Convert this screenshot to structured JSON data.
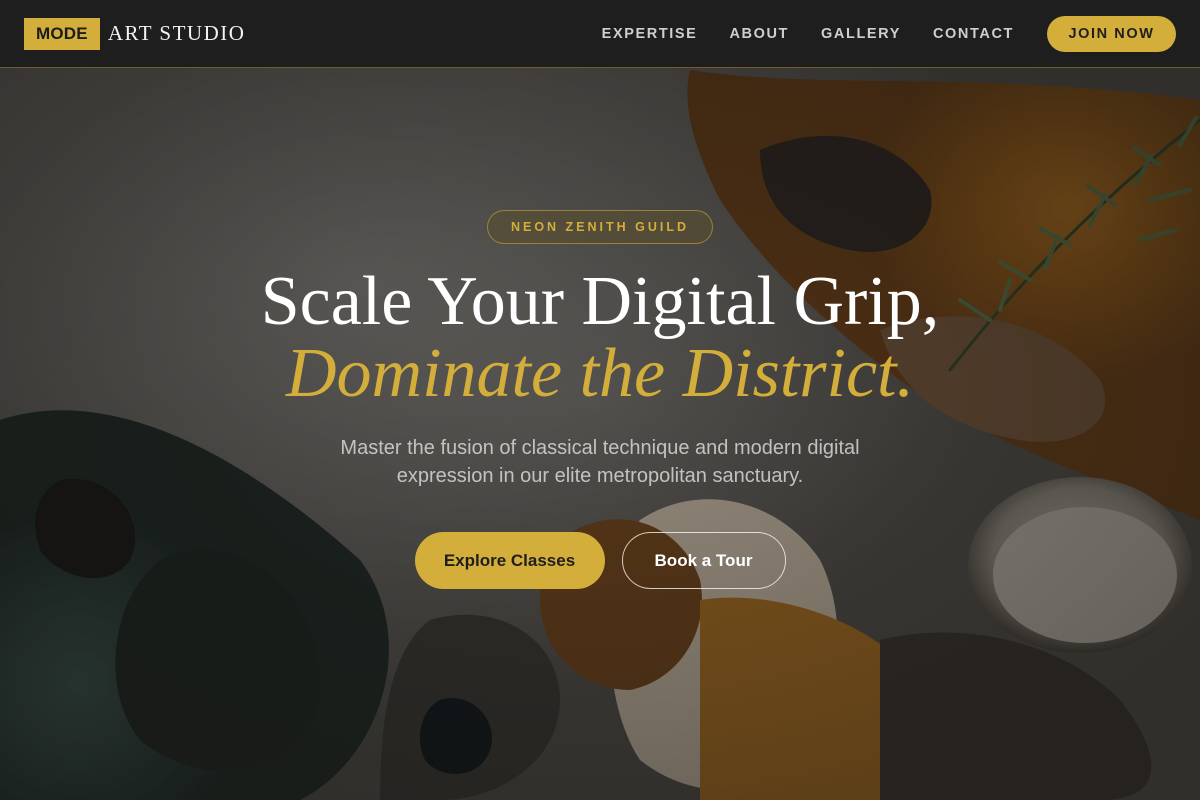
{
  "header": {
    "brand_badge": "MODE",
    "brand_text": "ART STUDIO",
    "nav": [
      {
        "label": "EXPERTISE"
      },
      {
        "label": "ABOUT"
      },
      {
        "label": "GALLERY"
      },
      {
        "label": "CONTACT"
      }
    ],
    "cta_label": "JOIN NOW"
  },
  "hero": {
    "badge": "NEON ZENITH GUILD",
    "title_line1": "Scale Your Digital Grip,",
    "title_line2": "Dominate the District.",
    "subtitle": "Master the fusion of classical technique and modern digital expression in our elite metropolitan sanctuary.",
    "primary_button": "Explore Classes",
    "secondary_button": "Book a Tour"
  },
  "colors": {
    "accent": "#d4ae3a",
    "header_bg": "#1e1e1e",
    "text_light": "#ffffff"
  },
  "icons": {
    "background": "oil-paint-palette-background"
  }
}
